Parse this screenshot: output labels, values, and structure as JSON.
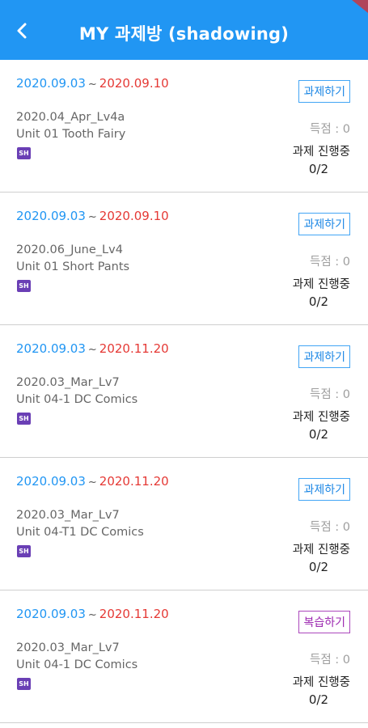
{
  "header": {
    "title": "MY 과제방 (shadowing)",
    "bg_color": "#2196f3"
  },
  "date_separator": "~",
  "items": [
    {
      "start_date": "2020.09.03",
      "end_date": "2020.09.10",
      "course": "2020.04_Apr_Lv4a",
      "unit": "Unit 01 Tooth Fairy",
      "badge": "SH",
      "button": "과제하기",
      "button_type": "assignment",
      "score": "득점 : 0",
      "status": "과제 진행중",
      "progress": "0/2"
    },
    {
      "start_date": "2020.09.03",
      "end_date": "2020.09.10",
      "course": "2020.06_June_Lv4",
      "unit": "Unit 01 Short Pants",
      "badge": "SH",
      "button": "과제하기",
      "button_type": "assignment",
      "score": "득점 : 0",
      "status": "과제 진행중",
      "progress": "0/2"
    },
    {
      "start_date": "2020.09.03",
      "end_date": "2020.11.20",
      "course": "2020.03_Mar_Lv7",
      "unit": "Unit 04-1 DC Comics",
      "badge": "SH",
      "button": "과제하기",
      "button_type": "assignment",
      "score": "득점 : 0",
      "status": "과제 진행중",
      "progress": "0/2"
    },
    {
      "start_date": "2020.09.03",
      "end_date": "2020.11.20",
      "course": "2020.03_Mar_Lv7",
      "unit": "Unit 04-T1 DC Comics",
      "badge": "SH",
      "button": "과제하기",
      "button_type": "assignment",
      "score": "득점 : 0",
      "status": "과제 진행중",
      "progress": "0/2"
    },
    {
      "start_date": "2020.09.03",
      "end_date": "2020.11.20",
      "course": "2020.03_Mar_Lv7",
      "unit": "Unit 04-1 DC Comics",
      "badge": "SH",
      "button": "복습하기",
      "button_type": "review",
      "score": "득점 : 0",
      "status": "과제 진행중",
      "progress": "0/2"
    }
  ],
  "colors": {
    "start_date": "#2196f3",
    "end_date": "#e53935",
    "assignment_button": "#1e88e5",
    "review_button": "#9c27b0",
    "badge": "#6a3fb5"
  }
}
